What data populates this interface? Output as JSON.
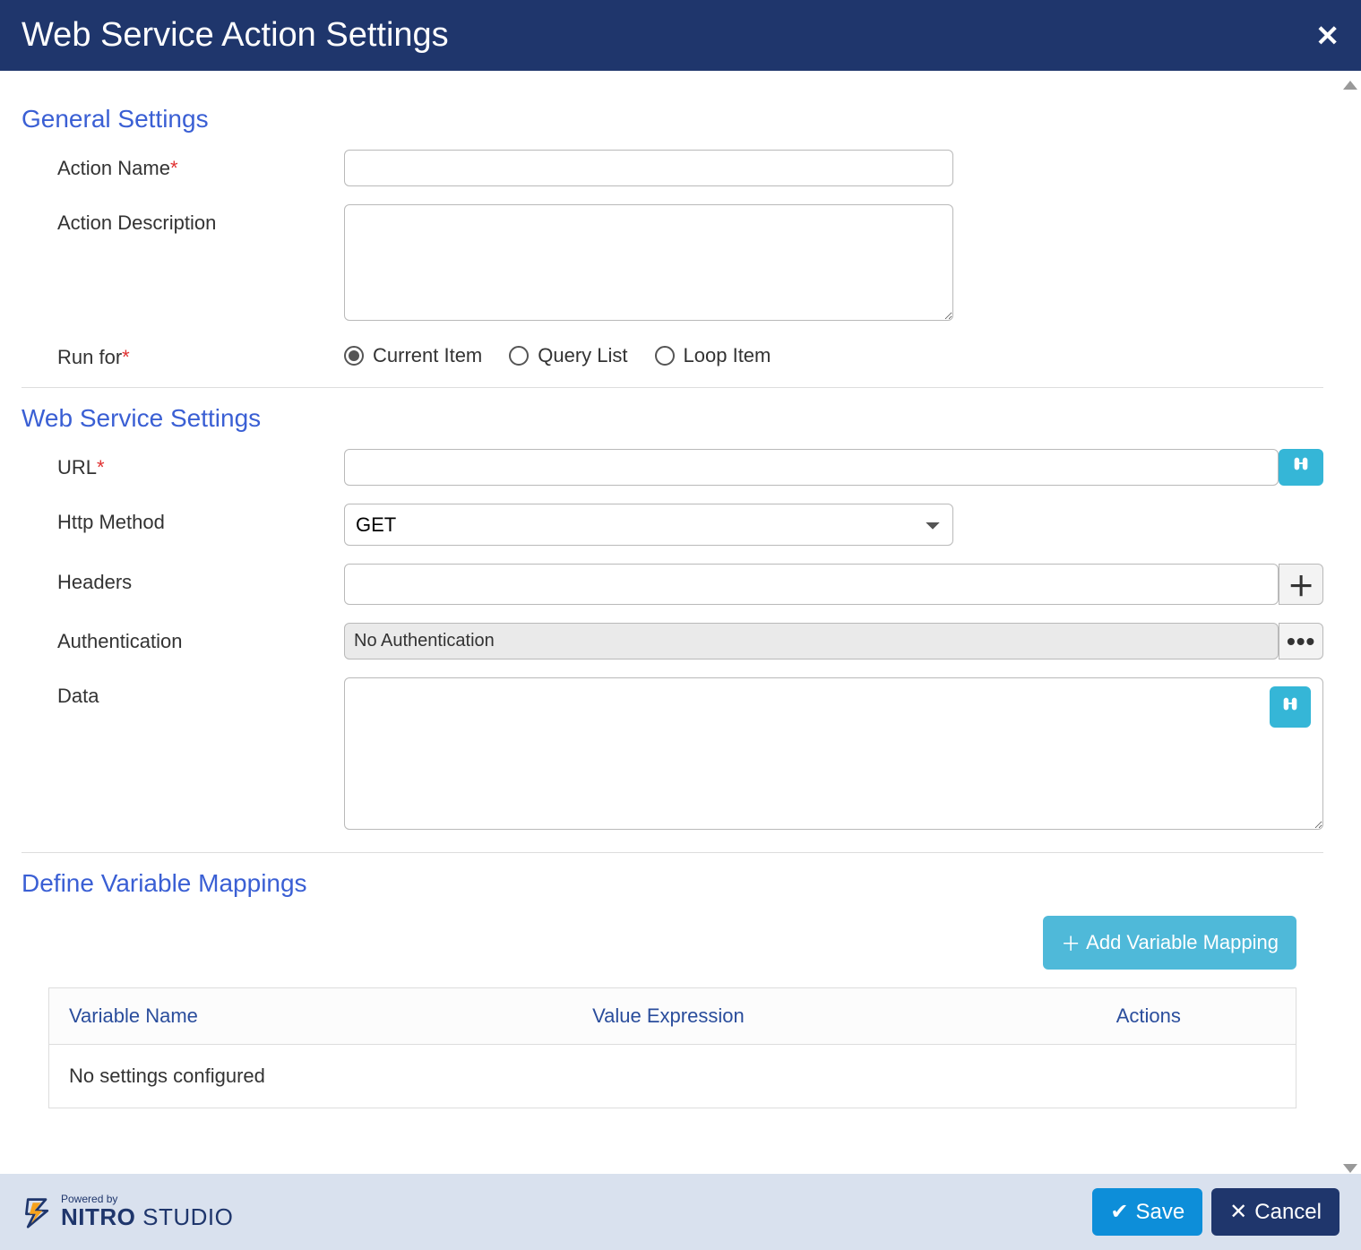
{
  "header": {
    "title": "Web Service Action Settings"
  },
  "general": {
    "heading": "General Settings",
    "labels": {
      "actionName": "Action Name",
      "actionDescription": "Action Description",
      "runFor": "Run for"
    },
    "values": {
      "actionName": "",
      "actionDescription": ""
    },
    "runForOptions": {
      "current": "Current Item",
      "query": "Query List",
      "loop": "Loop Item",
      "selected": "current"
    }
  },
  "webservice": {
    "heading": "Web Service Settings",
    "labels": {
      "url": "URL",
      "httpMethod": "Http Method",
      "headers": "Headers",
      "authentication": "Authentication",
      "data": "Data"
    },
    "values": {
      "url": "",
      "httpMethod": "GET",
      "headers": "",
      "authentication": "No Authentication",
      "data": ""
    }
  },
  "mappings": {
    "heading": "Define Variable Mappings",
    "addButton": "Add Variable Mapping",
    "columns": {
      "variableName": "Variable Name",
      "valueExpression": "Value Expression",
      "actions": "Actions"
    },
    "emptyText": "No settings configured"
  },
  "footer": {
    "poweredBy": "Powered by",
    "brandBold": "NITRO",
    "brandLight": "STUDIO",
    "save": "Save",
    "cancel": "Cancel"
  }
}
